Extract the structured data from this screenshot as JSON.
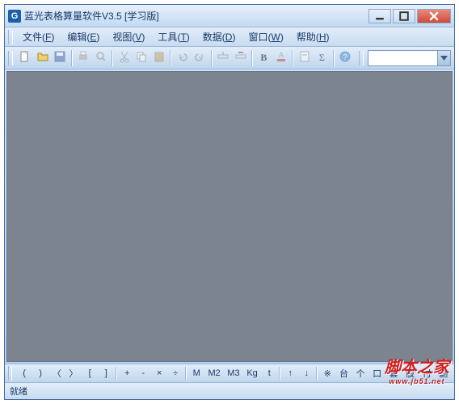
{
  "titlebar": {
    "title": "蓝光表格算量软件V3.5 [学习版]",
    "app_icon_letter": "G"
  },
  "menubar": {
    "items": [
      {
        "label": "文件",
        "hotkey": "F"
      },
      {
        "label": "编辑",
        "hotkey": "E"
      },
      {
        "label": "视图",
        "hotkey": "V"
      },
      {
        "label": "工具",
        "hotkey": "T"
      },
      {
        "label": "数据",
        "hotkey": "D"
      },
      {
        "label": "窗口",
        "hotkey": "W"
      },
      {
        "label": "帮助",
        "hotkey": "H"
      }
    ]
  },
  "toolbar_main": {
    "combo_value": ""
  },
  "bottom_toolbar": {
    "items": [
      "(",
      ")",
      "〈",
      "〉",
      "[",
      "]",
      "+",
      "-",
      "×",
      "÷",
      "|",
      "M",
      "M2",
      "M3",
      "Kg",
      "t",
      "↑",
      "↓",
      "|",
      "※",
      "台",
      "个",
      "口",
      "套",
      "股",
      "付",
      "副"
    ]
  },
  "statusbar": {
    "text": "就绪"
  },
  "watermark": {
    "main": "脚本之家",
    "sub": "www.jb51.net"
  }
}
